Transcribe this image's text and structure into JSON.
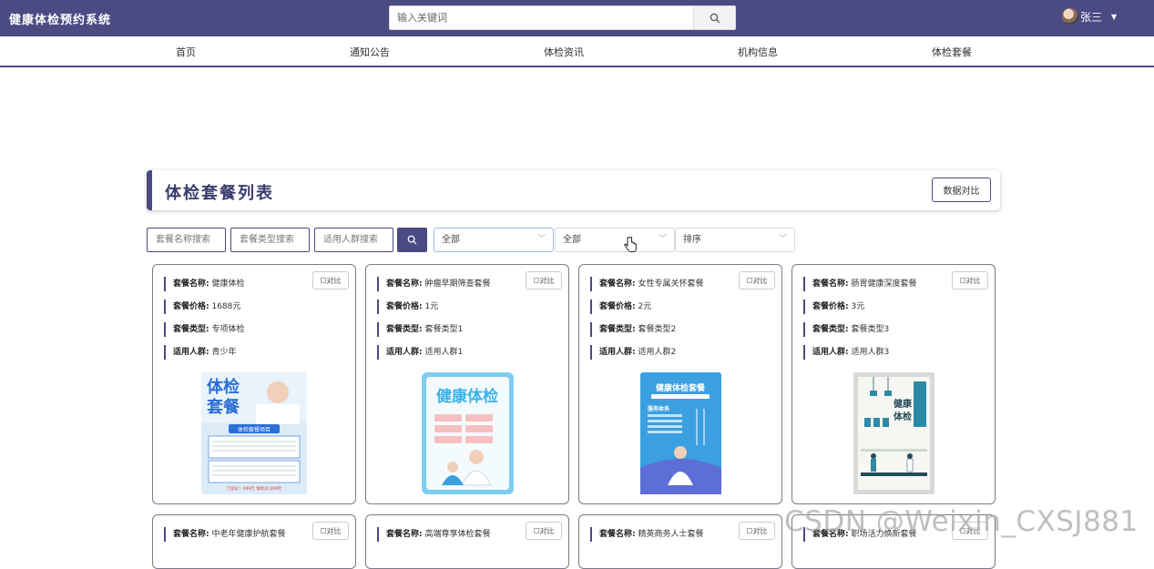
{
  "app": {
    "title": "健康体检预约系统"
  },
  "search": {
    "placeholder": "输入关键词"
  },
  "user": {
    "name": "张三"
  },
  "nav": [
    {
      "label": "首页"
    },
    {
      "label": "通知公告"
    },
    {
      "label": "体检资讯"
    },
    {
      "label": "机构信息"
    },
    {
      "label": "体检套餐"
    }
  ],
  "list": {
    "title": "体检套餐列表",
    "compare_button": "数据对比"
  },
  "filters": {
    "name_placeholder": "套餐名称搜索",
    "type_placeholder": "套餐类型搜索",
    "crowd_placeholder": "适用人群搜索",
    "select1": "全部",
    "select2": "全部",
    "sort": "排序"
  },
  "labels": {
    "name": "套餐名称:",
    "price": "套餐价格:",
    "type": "套餐类型:",
    "crowd": "适用人群:",
    "compare": "对比"
  },
  "packages": [
    {
      "name": "健康体检",
      "price": "1688元",
      "type": "专项体检",
      "crowd": "青少年",
      "poster_text": [
        "体检",
        "套餐",
        "体检套餐项目",
        "门诊价：499元 体检价:299元"
      ]
    },
    {
      "name": "肿瘤早期筛查套餐",
      "price": "1元",
      "type": "套餐类型1",
      "crowd": "适用人群1",
      "poster_text": [
        "健康体检"
      ]
    },
    {
      "name": "女性专属关怀套餐",
      "price": "2元",
      "type": "套餐类型2",
      "crowd": "适用人群2",
      "poster_text": [
        "健康体检套餐",
        "服务体系"
      ]
    },
    {
      "name": "肠胃健康深度套餐",
      "price": "3元",
      "type": "套餐类型3",
      "crowd": "适用人群3",
      "poster_text": [
        "健康",
        "体检"
      ]
    },
    {
      "name": "中老年健康护航套餐"
    },
    {
      "name": "高端尊享体检套餐"
    },
    {
      "name": "精英商务人士套餐"
    },
    {
      "name": "职场活力焕新套餐"
    }
  ],
  "watermark": "CSDN @Weixin_CXSJ881",
  "colors": {
    "primary": "#4b4a83",
    "poster_blue": "#3aa0e0"
  }
}
